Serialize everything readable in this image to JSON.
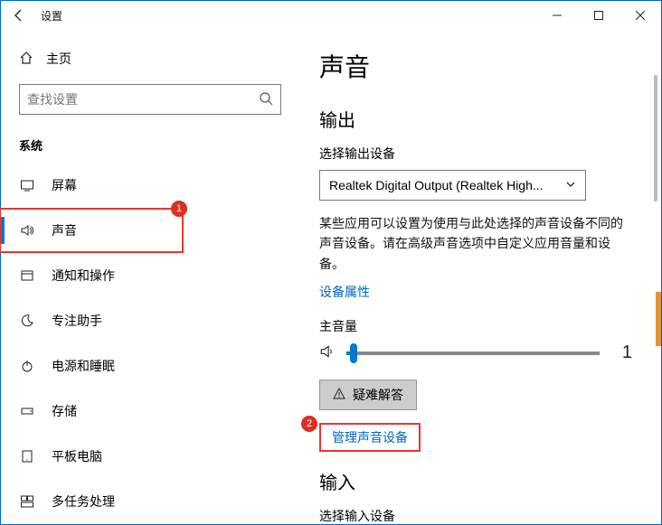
{
  "window": {
    "title": "设置",
    "controls": {
      "minimize": "—",
      "maximize": "□",
      "close": "✕"
    }
  },
  "sidebar": {
    "home": "主页",
    "search_placeholder": "查找设置",
    "section": "系统",
    "items": [
      {
        "label": "屏幕"
      },
      {
        "label": "声音"
      },
      {
        "label": "通知和操作"
      },
      {
        "label": "专注助手"
      },
      {
        "label": "电源和睡眠"
      },
      {
        "label": "存储"
      },
      {
        "label": "平板电脑"
      },
      {
        "label": "多任务处理"
      }
    ],
    "badge1": "1"
  },
  "main": {
    "title": "声音",
    "output_heading": "输出",
    "output_label": "选择输出设备",
    "output_device": "Realtek Digital Output (Realtek High...",
    "hint": "某些应用可以设置为使用与此处选择的声音设备不同的声音设备。请在高级声音选项中自定义应用音量和设备。",
    "device_props_link": "设备属性",
    "volume_label": "主音量",
    "volume_value": "1",
    "troubleshoot": "疑难解答",
    "manage_devices": "管理声音设备",
    "input_heading": "输入",
    "input_label": "选择输入设备",
    "badge2": "2"
  }
}
